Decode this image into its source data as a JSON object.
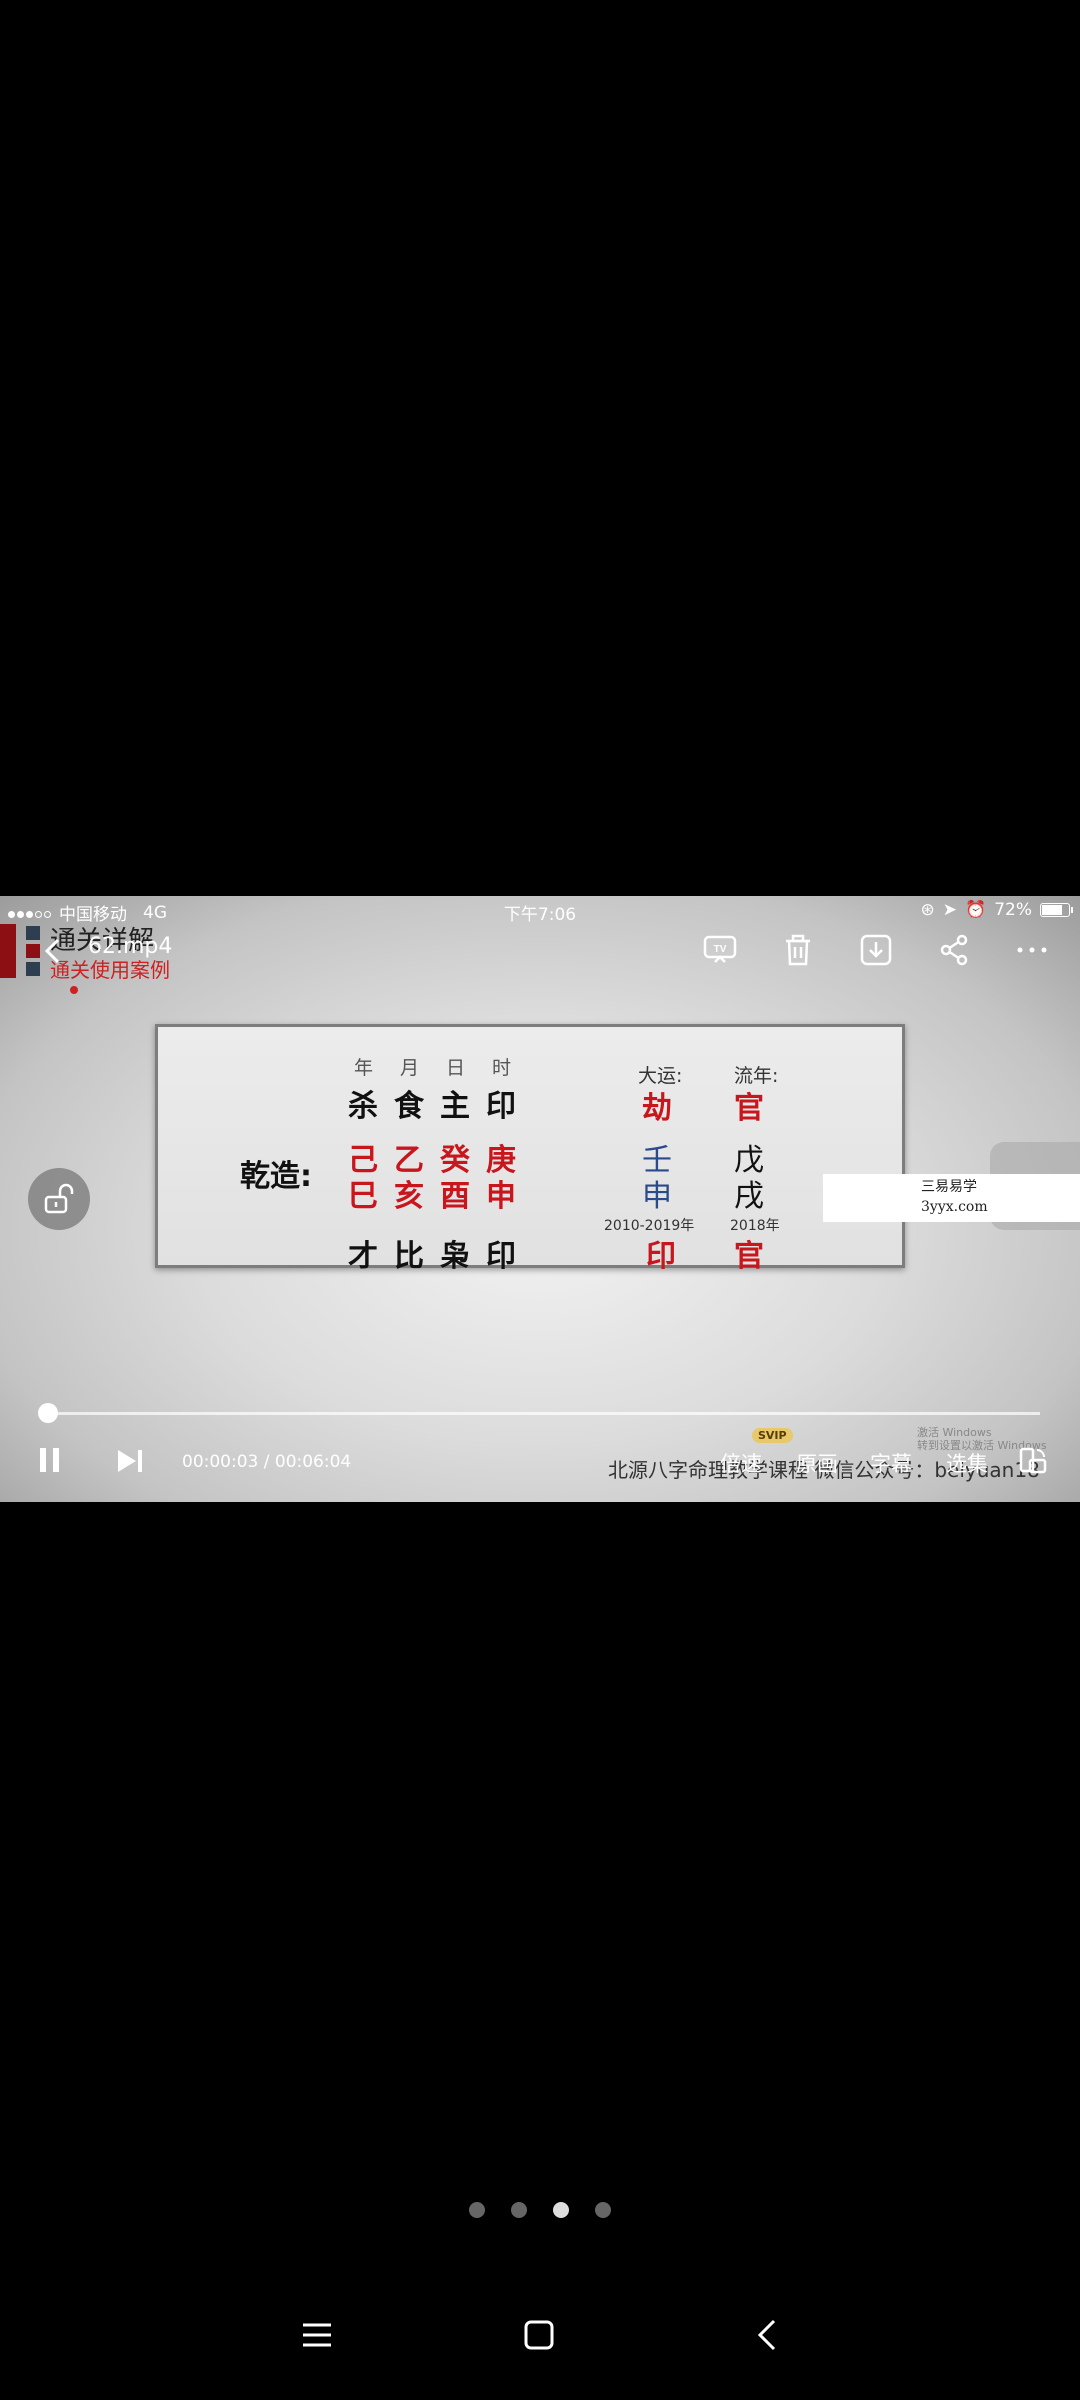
{
  "status_bar": {
    "carrier": "中国移动",
    "network": "4G",
    "time": "下午7:06",
    "battery": "72%"
  },
  "video": {
    "title": "62.mp4",
    "course_title": "通关详解",
    "course_subtitle": "通关使用案例",
    "board": {
      "column_headers": [
        "年",
        "月",
        "日",
        "时"
      ],
      "ten_gods_top": [
        "杀",
        "食",
        "主",
        "印"
      ],
      "label": "乾造:",
      "stems": [
        "己",
        "乙",
        "癸",
        "庚"
      ],
      "branches": [
        "巳",
        "亥",
        "酉",
        "申"
      ],
      "ten_gods_bottom": [
        "才",
        "比",
        "枭",
        "印"
      ],
      "dayun_header": "大运:",
      "liunian_header": "流年:",
      "dayun_god": "劫",
      "liunian_god": "官",
      "dayun_stem": "壬",
      "liunian_stem": "戊",
      "dayun_branch": "申",
      "liunian_branch": "戌",
      "dayun_years": "2010-2019年",
      "liunian_year": "2018年",
      "dayun_god_bottom": "印",
      "liunian_god_bottom": "官"
    },
    "watermark_line1": "三易易学",
    "watermark_line2": "3yyx.com",
    "credit": "北源八字命理教学课程 微信公众号：beiyuan18",
    "win_mark_line1": "激活 Windows",
    "win_mark_line2": "转到设置以激活 Windows"
  },
  "player": {
    "current_time": "00:00:03",
    "total_time": "00:06:04",
    "time_display": "00:00:03 / 00:06:04",
    "progress": 0.008,
    "speed_label": "倍速",
    "svip_badge": "SVIP",
    "quality_label": "原画",
    "subtitle_label": "字幕",
    "episodes_label": "选集"
  },
  "pager": {
    "count": 4,
    "active": 2
  },
  "icons": {
    "back": "back-arrow-icon",
    "cast": "tv-cast-icon",
    "delete": "trash-icon",
    "download": "download-icon",
    "share": "share-icon",
    "more": "more-icon",
    "lock": "unlock-icon",
    "pause": "pause-icon",
    "next": "next-icon",
    "rotate": "rotate-icon"
  }
}
